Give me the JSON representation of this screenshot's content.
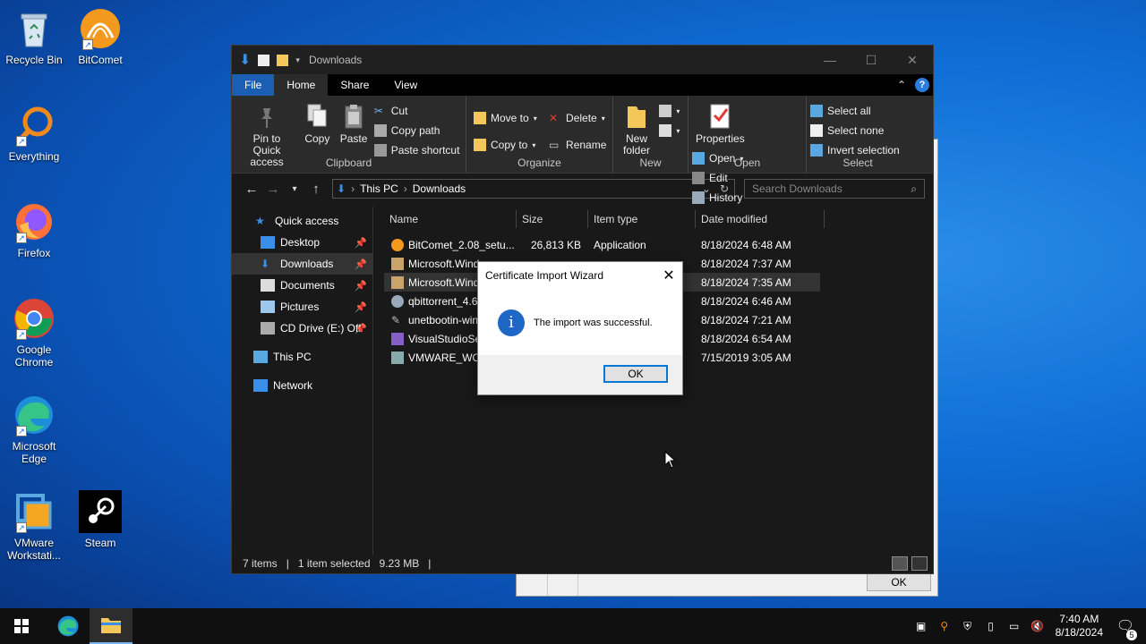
{
  "desktop": {
    "icons": [
      {
        "label": "Recycle Bin"
      },
      {
        "label": "BitComet"
      },
      {
        "label": "Everything"
      },
      {
        "label": "Firefox"
      },
      {
        "label": "Google Chrome"
      },
      {
        "label": "Microsoft Edge"
      },
      {
        "label": "VMware Workstati..."
      },
      {
        "label": "Steam"
      }
    ]
  },
  "background_window": {
    "ok_label": "OK"
  },
  "explorer": {
    "title": "Downloads",
    "tabs": {
      "file": "File",
      "home": "Home",
      "share": "Share",
      "view": "View"
    },
    "ribbon": {
      "clipboard": {
        "pin": "Pin to Quick access",
        "copy": "Copy",
        "paste": "Paste",
        "cut": "Cut",
        "copy_path": "Copy path",
        "paste_shortcut": "Paste shortcut",
        "group": "Clipboard"
      },
      "organize": {
        "move_to": "Move to",
        "copy_to": "Copy to",
        "delete": "Delete",
        "rename": "Rename",
        "group": "Organize"
      },
      "new": {
        "new_folder": "New folder",
        "group": "New"
      },
      "open": {
        "properties": "Properties",
        "open": "Open",
        "edit": "Edit",
        "history": "History",
        "group": "Open"
      },
      "select": {
        "select_all": "Select all",
        "select_none": "Select none",
        "invert": "Invert selection",
        "group": "Select"
      }
    },
    "address": {
      "crumb1": "This PC",
      "crumb2": "Downloads"
    },
    "search_placeholder": "Search Downloads",
    "nav": {
      "quick_access": "Quick access",
      "desktop": "Desktop",
      "downloads": "Downloads",
      "documents": "Documents",
      "pictures": "Pictures",
      "cd_drive": "CD Drive (E:) Off",
      "this_pc": "This PC",
      "network": "Network"
    },
    "columns": {
      "name": "Name",
      "size": "Size",
      "type": "Item type",
      "date": "Date modified"
    },
    "files": [
      {
        "name": "BitComet_2.08_setu...",
        "size": "26,813 KB",
        "type": "Application",
        "date": "8/18/2024 6:48 AM"
      },
      {
        "name": "Microsoft.Wind",
        "size": "",
        "type": "",
        "date": "8/18/2024 7:37 AM"
      },
      {
        "name": "Microsoft.Wind",
        "size": "",
        "type": "",
        "date": "8/18/2024 7:35 AM"
      },
      {
        "name": "qbittorrent_4.6",
        "size": "",
        "type": "",
        "date": "8/18/2024 6:46 AM"
      },
      {
        "name": "unetbootin-win",
        "size": "",
        "type": "",
        "date": "8/18/2024 7:21 AM"
      },
      {
        "name": "VisualStudioSe",
        "size": "",
        "type": "",
        "date": "8/18/2024 6:54 AM"
      },
      {
        "name": "VMWARE_WO",
        "size": "",
        "type": "",
        "date": "7/15/2019 3:05 AM"
      }
    ],
    "status": {
      "items": "7 items",
      "selected": "1 item selected",
      "size": "9.23 MB"
    }
  },
  "dialog": {
    "title": "Certificate Import Wizard",
    "message": "The import was successful.",
    "ok": "OK"
  },
  "taskbar": {
    "time": "7:40 AM",
    "date": "8/18/2024",
    "notification_count": "5"
  }
}
